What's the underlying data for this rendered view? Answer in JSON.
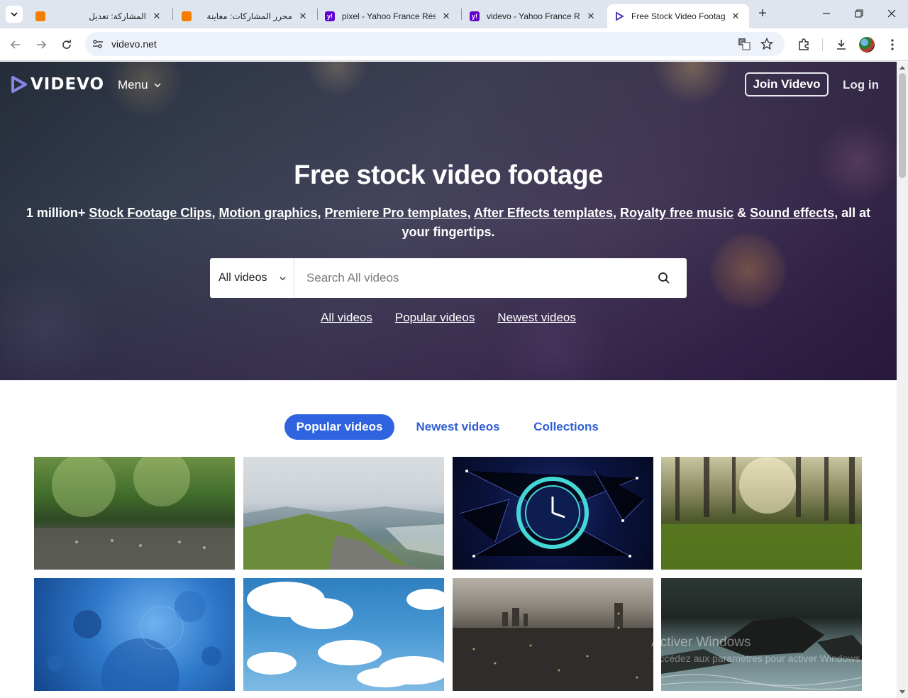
{
  "browser": {
    "tabs": [
      {
        "title": "المشاركة: تعديل",
        "favicon": "blogger-icon",
        "active": false
      },
      {
        "title": "محرر المشاركات: معاينة",
        "favicon": "blogger-icon",
        "active": false
      },
      {
        "title": "pixel - Yahoo France Résu",
        "favicon": "yahoo-icon",
        "active": false
      },
      {
        "title": "videvo - Yahoo France Ré",
        "favicon": "yahoo-icon",
        "active": false
      },
      {
        "title": "Free Stock Video Footage",
        "favicon": "videvo-icon",
        "active": true
      }
    ],
    "yahoo_fav_text": "y!",
    "new_tab_label": "+",
    "address": "videvo.net"
  },
  "site": {
    "logo_text": "VIDEVO",
    "menu_label": "Menu",
    "join_label": "Join Videvo",
    "login_label": "Log in"
  },
  "hero": {
    "title": "Free stock video footage",
    "subtitle_prefix": "1 million+ ",
    "subtitle_links": [
      "Stock Footage Clips",
      "Motion graphics",
      "Premiere Pro templates",
      "After Effects templates",
      "Royalty free music",
      "Sound effects"
    ],
    "sep_comma": ", ",
    "sep_amp": " & ",
    "subtitle_suffix": ", all at your fingertips.",
    "search_category": "All videos",
    "search_placeholder": "Search All videos",
    "quick_links": [
      "All videos",
      "Popular videos",
      "Newest videos"
    ]
  },
  "content": {
    "tabs": [
      {
        "label": "Popular videos",
        "active": true
      },
      {
        "label": "Newest videos",
        "active": false
      },
      {
        "label": "Collections",
        "active": false
      }
    ],
    "thumbnails": [
      {
        "name": "rain-on-water-thumbnail"
      },
      {
        "name": "coastline-thumbnail"
      },
      {
        "name": "clock-network-thumbnail"
      },
      {
        "name": "forest-grass-thumbnail"
      },
      {
        "name": "blue-cells-thumbnail"
      },
      {
        "name": "clouds-sky-thumbnail"
      },
      {
        "name": "city-skyline-thumbnail"
      },
      {
        "name": "river-rocks-thumbnail"
      }
    ]
  },
  "os_watermark": {
    "line1": "Activer Windows",
    "line2": "Accédez aux paramètres pour activer Windows."
  },
  "colors": {
    "accent": "#2f63e0",
    "link_blue": "#2f5fd6",
    "tabbar": "#dfe5ee"
  }
}
